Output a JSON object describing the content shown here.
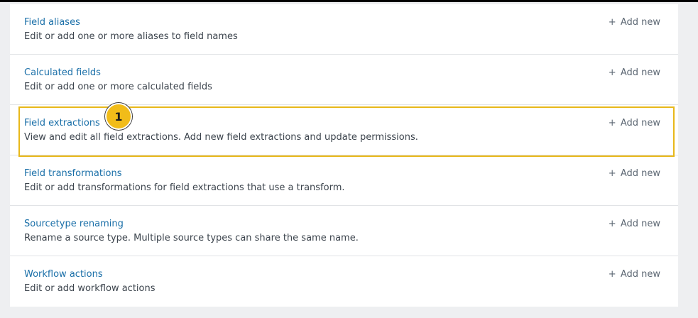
{
  "colors": {
    "link": "#1a6fa8",
    "description": "#3c444d",
    "add_new": "#5c6773",
    "highlight": "#e8b81a",
    "badge": "#f1bc19",
    "background": "#eeeff1"
  },
  "rows": [
    {
      "title": "Field aliases",
      "description": "Edit or add one or more aliases to field names",
      "action_icon": "plus-icon",
      "action_label": "Add new"
    },
    {
      "title": "Calculated fields",
      "description": "Edit or add one or more calculated fields",
      "action_icon": "plus-icon",
      "action_label": "Add new"
    },
    {
      "title": "Field extractions",
      "description": "View and edit all field extractions. Add new field extractions and update permissions.",
      "action_icon": "plus-icon",
      "action_label": "Add new"
    },
    {
      "title": "Field transformations",
      "description": "Edit or add transformations for field extractions that use a transform.",
      "action_icon": "plus-icon",
      "action_label": "Add new"
    },
    {
      "title": "Sourcetype renaming",
      "description": "Rename a source type. Multiple source types can share the same name.",
      "action_icon": "plus-icon",
      "action_label": "Add new"
    },
    {
      "title": "Workflow actions",
      "description": "Edit or add workflow actions",
      "action_icon": "plus-icon",
      "action_label": "Add new"
    }
  ],
  "annotation": {
    "step_number": "1",
    "highlighted_row": "Field extractions"
  }
}
